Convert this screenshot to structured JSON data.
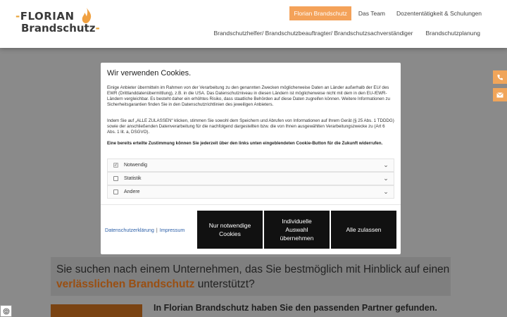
{
  "logo": {
    "line1": "FLORIAN",
    "line2": "Brandschutz"
  },
  "nav": {
    "top": [
      "Florian Brandschutz",
      "Das Team",
      "Dozententätigkeit & Schulungen"
    ],
    "bottom": [
      "Brandschutzhelfer/ Brandschutzbeauftragter/ Brandschutzsachverständiger",
      "Brandschutzplanung"
    ]
  },
  "content": {
    "headline_before": "Sie suchen nach einem Unternehmen, das Sie bestmöglich mit Hinblick auf einen ",
    "headline_highlight": "verlässlichen Brandschutz",
    "headline_after": " unterstützt?",
    "subheadline": "In Florian Brandschutz haben Sie den passenden Partner gefunden."
  },
  "cookie": {
    "title": "Wir verwenden Cookies.",
    "p1": "Einige Anbieter übermitteln im Rahmen von der Verarbeitung zu den genannten Zwecken möglicherweise Daten an Länder außerhalb der EU/ des EWR (Drittlanddatenübermittlung), z.B. in die USA. Das Datenschutzniveau in diesen Ländern ist möglicherweise nicht mit dem in den EU-/EWR-Ländern vergleichbar. Es besteht daher ein erhöhtes Risiko, dass staatliche Behörden auf diese Daten zugreifen können. Weitere Informationen zu Sicherheitsgarantien finden Sie in den Datenschutzrichtlinien des jeweiligen Anbieters.",
    "p2": "Indem Sie auf „ALLE ZULASSEN“ klicken, stimmen Sie sowohl dem Speichern und Abrufen von Informationen auf Ihrem Gerät (§ 25 Abs. 1 TDDDG) sowie der anschließenden Datenverarbeitung für die nachfolgend dargestellten bzw. die von Ihnen ausgewählten Verarbeitungszwecke zu (Art 6 Abs. 1 lit. a, DSGVO).",
    "p3": "Eine bereits erteilte Zustimmung können Sie jederzeit über den links unten eingeblendeten Cookie-Button für die Zukunft widerrufen.",
    "categories": [
      {
        "label": "Notwendig",
        "checked": true
      },
      {
        "label": "Statistik",
        "checked": false
      },
      {
        "label": "Andere",
        "checked": false
      }
    ],
    "links": {
      "privacy": "Datenschutzerklärung",
      "separator": "|",
      "imprint": "Impressum"
    },
    "buttons": {
      "necessary": "Nur notwendige Cookies",
      "individual": "Individuelle Auswahl übernehmen",
      "all": "Alle zulassen"
    }
  },
  "colors": {
    "accent": "#f4a259",
    "button": "#111111",
    "highlight": "#9a4f12"
  }
}
